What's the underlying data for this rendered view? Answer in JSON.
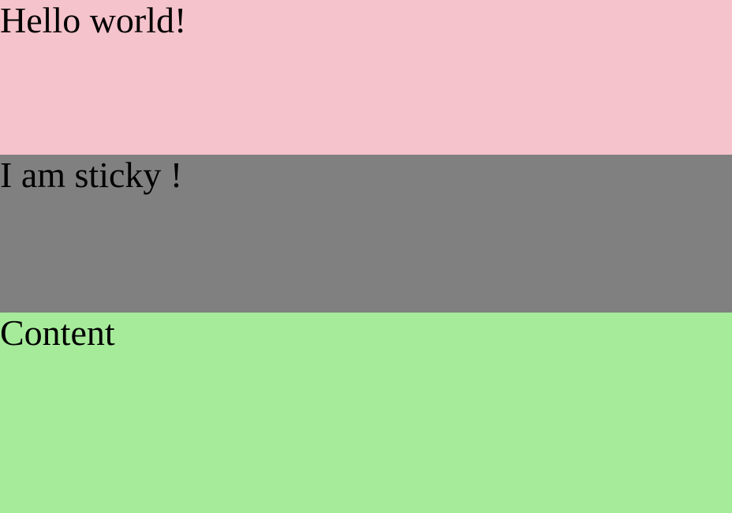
{
  "header": {
    "text": "Hello world!",
    "background": "#f5c3cb"
  },
  "sticky": {
    "text": "I am sticky !",
    "background": "#808080"
  },
  "content": {
    "text": "Content",
    "background": "#a6eb9a"
  }
}
